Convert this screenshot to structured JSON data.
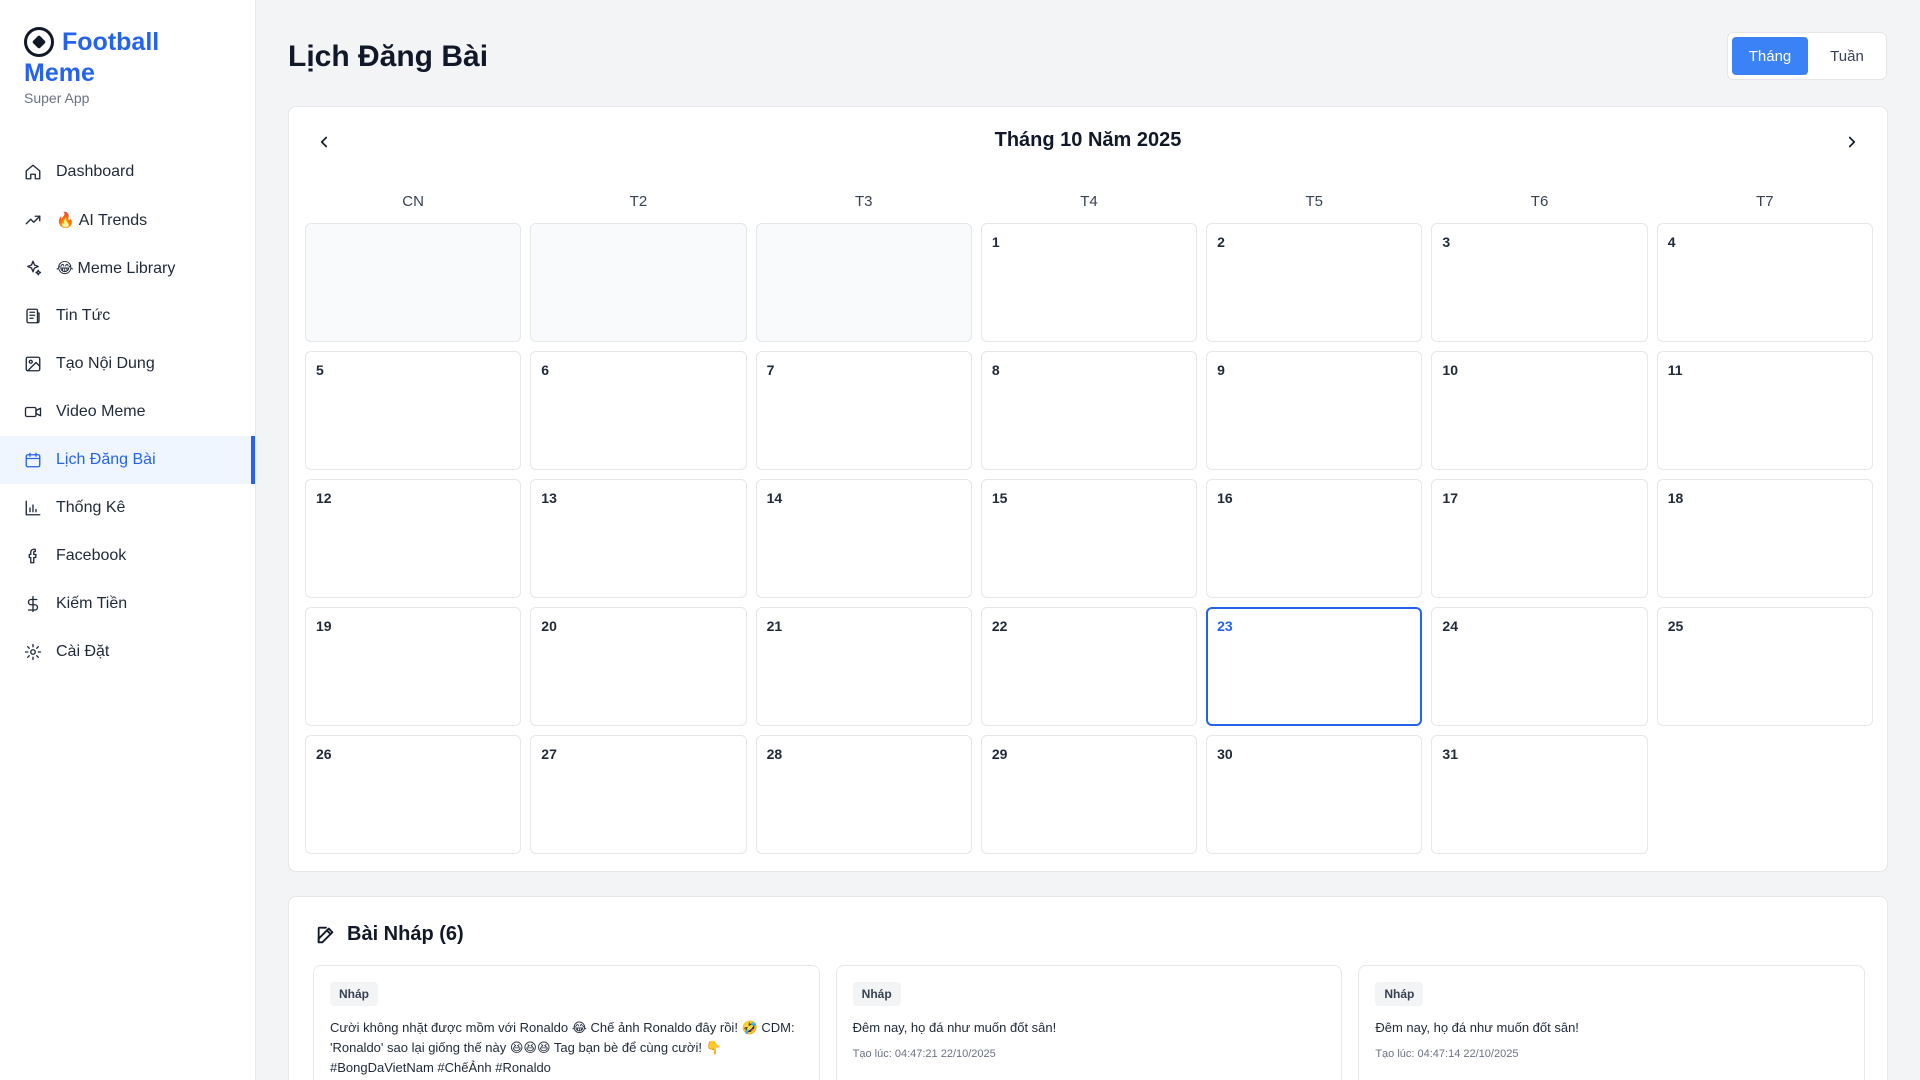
{
  "brand": {
    "title_line1": "Football",
    "title_line2": "Meme",
    "subtitle": "Super App",
    "logo_icon": "soccer-ball-icon"
  },
  "nav": {
    "items": [
      {
        "label": "Dashboard",
        "icon": "home-icon",
        "emoji": ""
      },
      {
        "label": "AI Trends",
        "icon": "trending-up-icon",
        "emoji": "🔥"
      },
      {
        "label": "Meme Library",
        "icon": "sparkles-icon",
        "emoji": "😂"
      },
      {
        "label": "Tin Tức",
        "icon": "newspaper-icon",
        "emoji": ""
      },
      {
        "label": "Tạo Nội Dung",
        "icon": "image-icon",
        "emoji": ""
      },
      {
        "label": "Video Meme",
        "icon": "video-icon",
        "emoji": ""
      },
      {
        "label": "Lịch Đăng Bài",
        "icon": "calendar-icon",
        "emoji": ""
      },
      {
        "label": "Thống Kê",
        "icon": "bar-chart-icon",
        "emoji": ""
      },
      {
        "label": "Facebook",
        "icon": "facebook-icon",
        "emoji": ""
      },
      {
        "label": "Kiếm Tiền",
        "icon": "dollar-icon",
        "emoji": ""
      },
      {
        "label": "Cài Đặt",
        "icon": "settings-icon",
        "emoji": ""
      }
    ],
    "active_index": 6
  },
  "page": {
    "title": "Lịch Đăng Bài"
  },
  "view_toggle": {
    "month": "Tháng",
    "week": "Tuần",
    "selected": "Tháng"
  },
  "calendar": {
    "title": "Tháng 10 Năm 2025",
    "weekdays": [
      "CN",
      "T2",
      "T3",
      "T4",
      "T5",
      "T6",
      "T7"
    ],
    "leading_empty": 3,
    "days_in_month": 31,
    "today": 23
  },
  "drafts": {
    "title": "Bài Nháp (6)",
    "items": [
      {
        "badge": "Nháp",
        "text": "Cười không nhặt được mồm với Ronaldo 😂 Chế ảnh Ronaldo đây rồi! 🤣 CDM: 'Ronaldo' sao lại giống thế này 😆😆😆 Tag bạn bè để cùng cười! 👇 #BongDaVietNam #ChếẢnh #Ronaldo",
        "time": ""
      },
      {
        "badge": "Nháp",
        "text": "Đêm nay, họ đá như muốn đốt sân!",
        "time": "Tạo lúc: 04:47:21 22/10/2025"
      },
      {
        "badge": "Nháp",
        "text": "Đêm nay, họ đá như muốn đốt sân!",
        "time": "Tạo lúc: 04:47:14 22/10/2025"
      }
    ]
  },
  "colors": {
    "accent": "#2563eb",
    "active_bg": "#eff6ff",
    "page_bg": "#f3f4f6"
  }
}
